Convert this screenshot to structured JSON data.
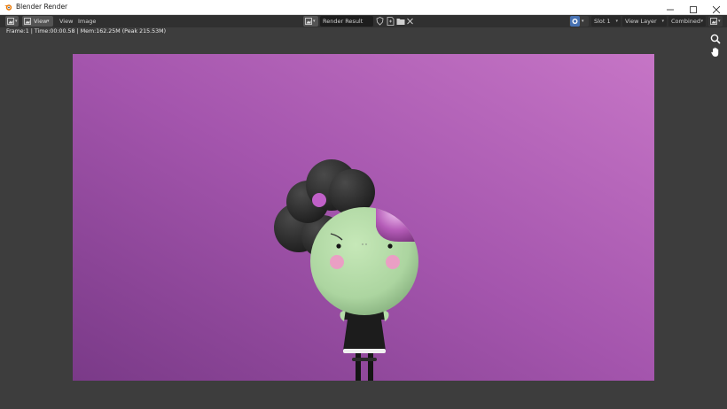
{
  "window": {
    "title": "Blender Render",
    "controls": [
      "minimize-icon",
      "maximize-icon",
      "close-icon"
    ]
  },
  "header": {
    "menus": [
      "View",
      "View",
      "Image"
    ],
    "image_name": "Render Result",
    "slot": "Slot 1",
    "view_layer": "View Layer",
    "pass": "Combined"
  },
  "status": {
    "text": "Frame:1 | Time:00:00.58 | Mem:162.25M (Peak 215.53M)"
  },
  "render": {
    "bg_left": "#7e3c8c",
    "bg_right": "#c270c4",
    "skin": "#b4dca8",
    "hair": "#2a2a2a",
    "cheek": "#ea9fc4",
    "dress": "#1c1c1c",
    "accent": "#c060c8"
  },
  "colors": {
    "header_bg": "#303030",
    "viewport_bg": "#3d3d3d",
    "accent_blue": "#4772b3"
  }
}
